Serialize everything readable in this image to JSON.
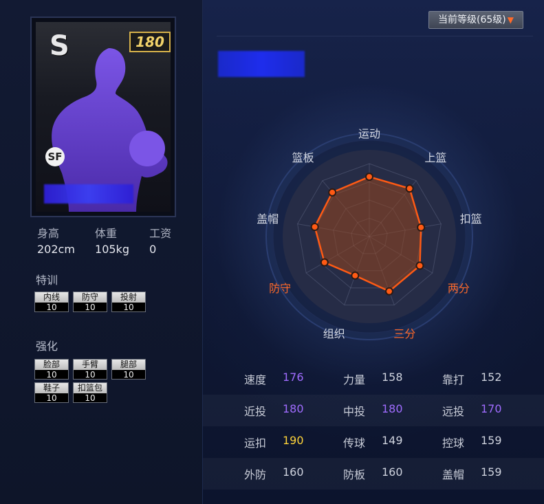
{
  "card": {
    "grade": "S",
    "overall": "180",
    "position": "SF"
  },
  "bio": {
    "height_label": "身高",
    "height_value": "202cm",
    "weight_label": "体重",
    "weight_value": "105kg",
    "salary_label": "工资",
    "salary_value": "0"
  },
  "special_training": {
    "title": "特训",
    "items": [
      {
        "label": "内线",
        "value": "10"
      },
      {
        "label": "防守",
        "value": "10"
      },
      {
        "label": "投射",
        "value": "10"
      }
    ]
  },
  "enhance": {
    "title": "强化",
    "items": [
      {
        "label": "脸部",
        "value": "10"
      },
      {
        "label": "手臂",
        "value": "10"
      },
      {
        "label": "腿部",
        "value": "10"
      },
      {
        "label": "鞋子",
        "value": "10"
      },
      {
        "label": "扣篮包",
        "value": "10"
      }
    ]
  },
  "level_dropdown": {
    "label": "当前等级(65级)"
  },
  "radar": {
    "axes": [
      {
        "label": "运动",
        "value": 0.82,
        "highlight": false
      },
      {
        "label": "上篮",
        "value": 0.86,
        "highlight": false
      },
      {
        "label": "扣篮",
        "value": 0.72,
        "highlight": false
      },
      {
        "label": "两分",
        "value": 0.8,
        "highlight": true
      },
      {
        "label": "三分",
        "value": 0.8,
        "highlight": true
      },
      {
        "label": "组织",
        "value": 0.57,
        "highlight": false
      },
      {
        "label": "防守",
        "value": 0.71,
        "highlight": true
      },
      {
        "label": "盖帽",
        "value": 0.76,
        "highlight": false
      },
      {
        "label": "篮板",
        "value": 0.79,
        "highlight": false
      }
    ],
    "colors": {
      "line": "#ff5a14",
      "dot": "#ff5a14",
      "label_highlight": "#ff6a2a",
      "label": "#d6dae4"
    }
  },
  "attributes": {
    "rows": [
      [
        {
          "k": "速度",
          "v": "176",
          "c": "purple"
        },
        {
          "k": "力量",
          "v": "158",
          "c": ""
        },
        {
          "k": "靠打",
          "v": "152",
          "c": ""
        }
      ],
      [
        {
          "k": "近投",
          "v": "180",
          "c": "purple"
        },
        {
          "k": "中投",
          "v": "180",
          "c": "purple"
        },
        {
          "k": "远投",
          "v": "170",
          "c": "purple"
        }
      ],
      [
        {
          "k": "运扣",
          "v": "190",
          "c": "gold"
        },
        {
          "k": "传球",
          "v": "149",
          "c": ""
        },
        {
          "k": "控球",
          "v": "159",
          "c": ""
        }
      ],
      [
        {
          "k": "外防",
          "v": "160",
          "c": ""
        },
        {
          "k": "防板",
          "v": "160",
          "c": ""
        },
        {
          "k": "盖帽",
          "v": "159",
          "c": ""
        }
      ]
    ]
  }
}
